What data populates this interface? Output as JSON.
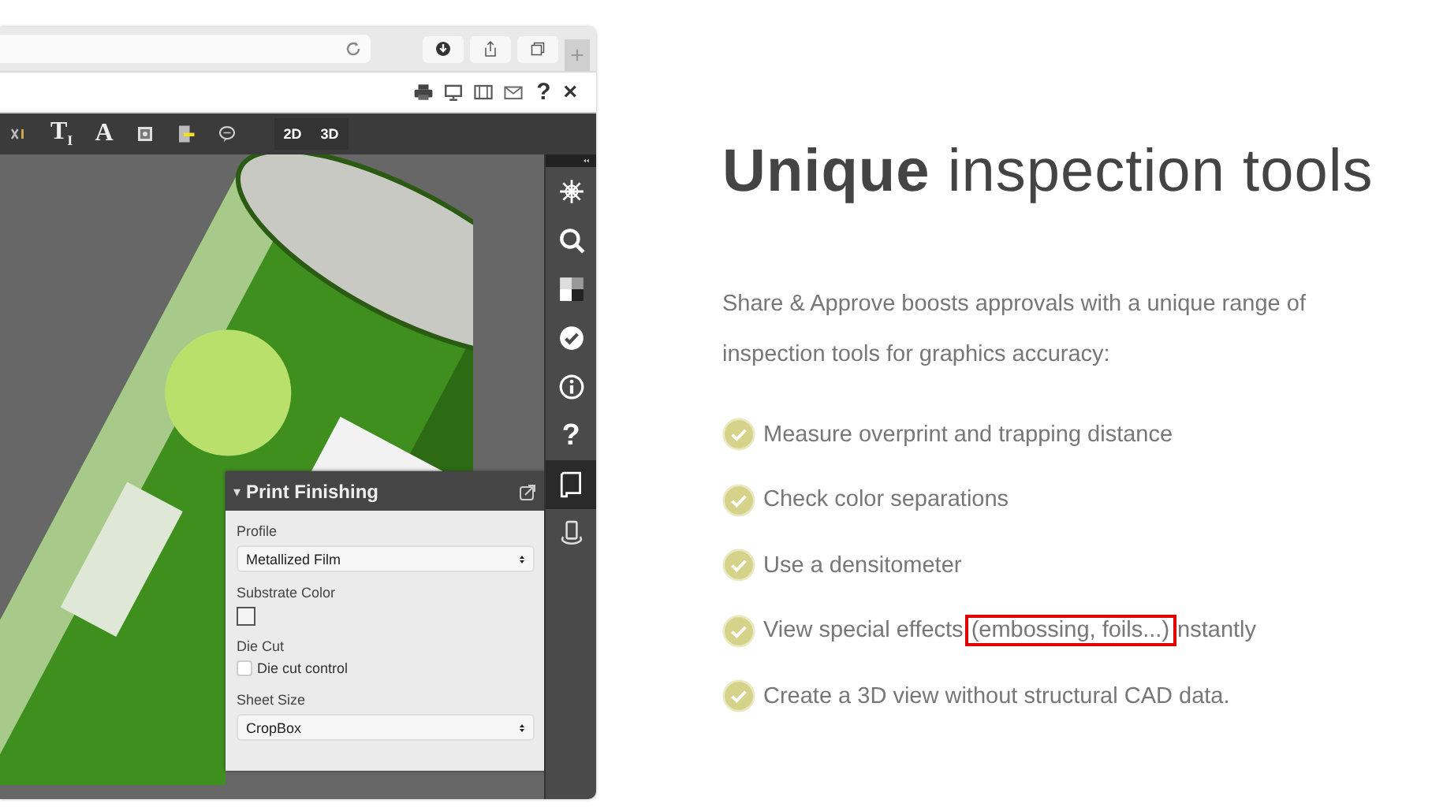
{
  "browser": {
    "toolbar_buttons": [
      {
        "kind": "download"
      },
      {
        "kind": "share"
      },
      {
        "kind": "tabs"
      }
    ],
    "new_tab": "+"
  },
  "app_header": {
    "actions": [
      {
        "kind": "print"
      },
      {
        "kind": "monitor"
      },
      {
        "kind": "panel"
      },
      {
        "kind": "mail"
      },
      {
        "kind": "glyph",
        "glyph": "?"
      },
      {
        "kind": "glyph",
        "glyph": "×"
      }
    ]
  },
  "toolbar": {
    "tools": [
      {
        "kind": "format"
      },
      {
        "kind": "glyph",
        "glyph": "T$_{I}$"
      },
      {
        "kind": "glyph",
        "glyph": "A"
      },
      {
        "kind": "image"
      },
      {
        "kind": "highlighter"
      },
      {
        "kind": "comment"
      }
    ],
    "view_modes": [
      {
        "label": "2D",
        "selected": false
      },
      {
        "label": "3D",
        "selected": false
      }
    ]
  },
  "sidebar": {
    "tools": [
      {
        "kind": "snowflake",
        "selected": false
      },
      {
        "kind": "search",
        "selected": false
      },
      {
        "kind": "separations",
        "selected": false
      },
      {
        "kind": "check",
        "selected": false
      },
      {
        "kind": "info",
        "selected": false
      },
      {
        "kind": "glyph",
        "glyph": "?",
        "selected": false
      },
      {
        "kind": "page",
        "selected": true
      },
      {
        "kind": "rotate3d",
        "selected": false
      }
    ]
  },
  "panel": {
    "title": "Print Finishing",
    "toggle": "▾",
    "expanded": true,
    "fields": [
      {
        "kind": "select",
        "label": "Profile",
        "value": "Metallized Film"
      },
      {
        "kind": "swatch",
        "label": "Substrate Color"
      },
      {
        "kind": "checkbox",
        "label": "Die Cut",
        "option": "Die cut control",
        "checked": false
      },
      {
        "kind": "select",
        "label": "Sheet Size",
        "value": "CropBox"
      }
    ]
  },
  "heading": "**Unique** inspection tools",
  "intro": "Share & Approve boosts approvals with a unique range of inspection tools for graphics accuracy:",
  "features": [
    {
      "text": "Measure overprint and trapping distance"
    },
    {
      "text": "Check color separations"
    },
    {
      "text": "Use a densitometer"
    },
    {
      "text": "View special effects",
      "highlight": "(embossing, foils...)",
      "text_after": "nstantly"
    },
    {
      "text": "Create a 3D view without structural CAD data."
    }
  ]
}
